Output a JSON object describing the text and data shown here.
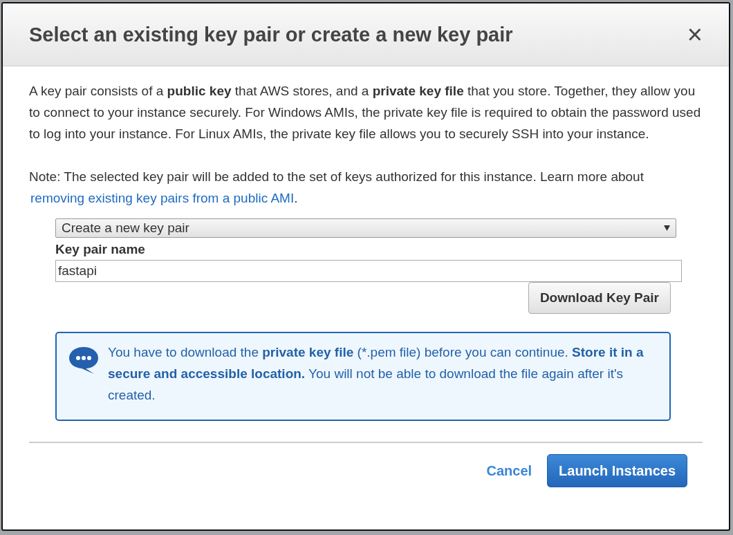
{
  "dialog": {
    "title": "Select an existing key pair or create a new key pair",
    "close": "×",
    "description": "A key pair consists of a **public key** that AWS stores, and a **private key file** that you store. Together, they allow you to connect to your instance securely. For Windows AMIs, the private key file is required to obtain the password used to log into your instance. For Linux AMIs, the private key file allows you to securely SSH into your instance.",
    "note": {
      "before": "Note: The selected key pair will be added to the set of keys authorized for this instance. Learn more about",
      "link": "removing existing key pairs from a public AMI",
      "after": "."
    },
    "key_pair_option": {
      "value": "Create a new key pair"
    },
    "key_pair_name": {
      "label": "Key pair name",
      "value": "fastapi"
    },
    "download_button": "Download Key Pair",
    "info": "You have to download the **private key file** (*.pem file) before you can continue. **Store it in a secure and accessible location.** You will not be able to download the file again after it's created.",
    "buttons": [
      {
        "label": "Cancel",
        "kind": "link"
      },
      {
        "label": "Launch Instances",
        "kind": "primary"
      }
    ]
  }
}
